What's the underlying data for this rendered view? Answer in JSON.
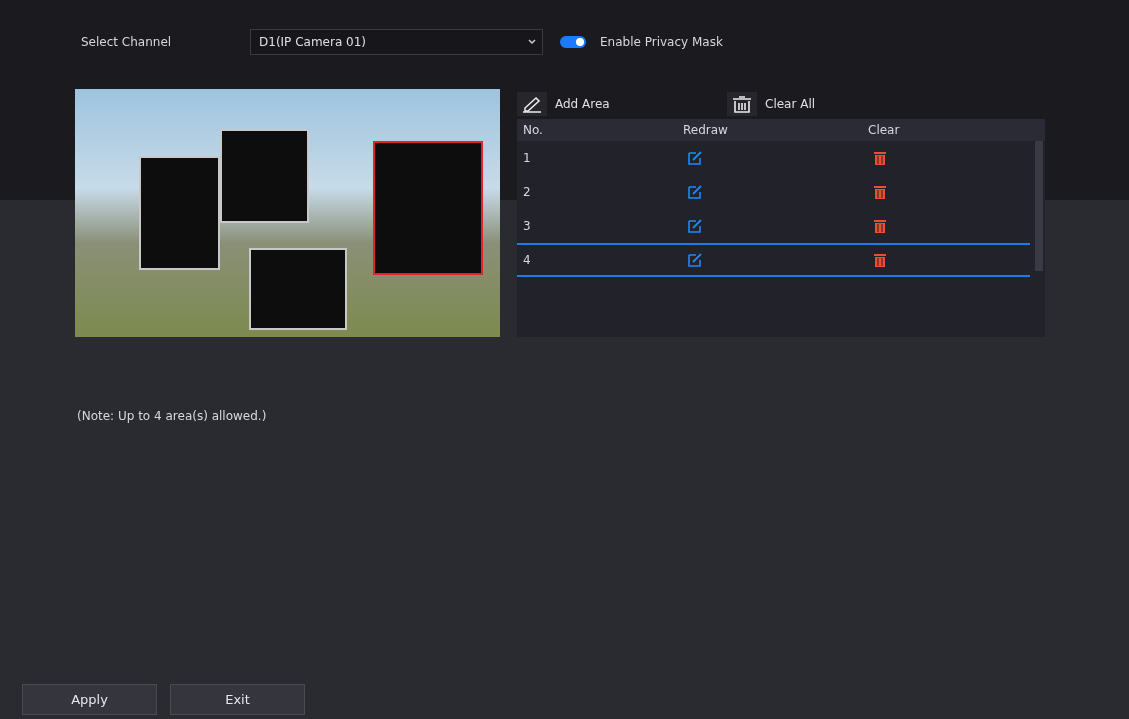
{
  "channel": {
    "label": "Select Channel",
    "value": "D1(IP Camera 01)"
  },
  "privacy_mask": {
    "label": "Enable Privacy Mask",
    "on": true
  },
  "preview": {
    "masks": [
      {
        "selected": false
      },
      {
        "selected": false
      },
      {
        "selected": false
      },
      {
        "selected": true
      }
    ]
  },
  "toolbar": [
    {
      "kind": "pen",
      "label": "Add Area"
    },
    {
      "kind": "trash",
      "label": "Clear All"
    }
  ],
  "table": {
    "columns": [
      "No.",
      "Redraw",
      "Clear"
    ],
    "rows": [
      {
        "no": "1",
        "selected": false
      },
      {
        "no": "2",
        "selected": false
      },
      {
        "no": "3",
        "selected": false
      },
      {
        "no": "4",
        "selected": true
      }
    ]
  },
  "note": "(Note: Up to 4 area(s) allowed.)",
  "buttons": [
    "Apply",
    "Exit"
  ]
}
